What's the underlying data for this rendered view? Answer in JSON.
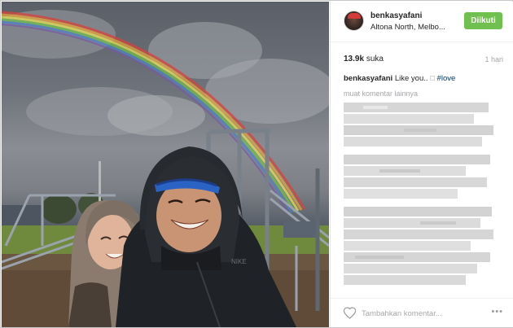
{
  "post": {
    "username": "benkasyafani",
    "location": "Altona North, Melbo...",
    "follow_label": "Diikuti",
    "likes": "13.9k",
    "likes_label": "suka",
    "time": "1 hari",
    "caption_user": "benkasyafani",
    "caption_text": "Like you..",
    "caption_symbol": "□",
    "caption_tag": "#love",
    "load_more": "muat komentar lainnya",
    "comment_placeholder": "Tambahkan komentar...",
    "more_options": "•••"
  },
  "colors": {
    "follow_button": "#70c050",
    "hashtag": "#003569",
    "muted": "#a5a7aa"
  },
  "icons": [
    "heart-icon",
    "more-options-icon",
    "avatar"
  ]
}
